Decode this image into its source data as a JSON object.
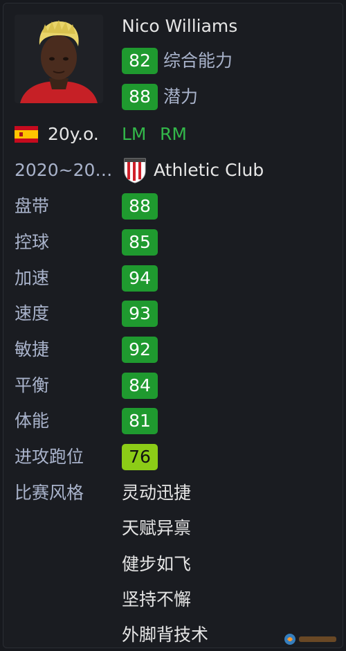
{
  "player": {
    "name": "Nico Williams",
    "age": "20y.o.",
    "tenure": "2020~20…",
    "club": "Athletic Club",
    "positions": [
      "LM",
      "RM"
    ],
    "overall_label": "综合能力",
    "overall": "82",
    "potential_label": "潜力",
    "potential": "88"
  },
  "attributes": [
    {
      "label": "盘带",
      "value": "88"
    },
    {
      "label": "控球",
      "value": "85"
    },
    {
      "label": "加速",
      "value": "94"
    },
    {
      "label": "速度",
      "value": "93"
    },
    {
      "label": "敏捷",
      "value": "92"
    },
    {
      "label": "平衡",
      "value": "84"
    },
    {
      "label": "体能",
      "value": "81"
    },
    {
      "label": "进攻跑位",
      "value": "76"
    }
  ],
  "styles": {
    "label": "比赛风格",
    "items": [
      "灵动迅捷",
      "天赋异禀",
      "健步如飞",
      "坚持不懈",
      "外脚背技术"
    ]
  },
  "icons": {
    "flag": "spain-flag-icon",
    "crest": "athletic-club-crest-icon",
    "photo": "player-photo"
  },
  "colors": {
    "rating_green": "#1f9a2f",
    "rating_lime": "#8ccc17",
    "position_green": "#33b84a",
    "label_blue": "#a9b3cb"
  }
}
